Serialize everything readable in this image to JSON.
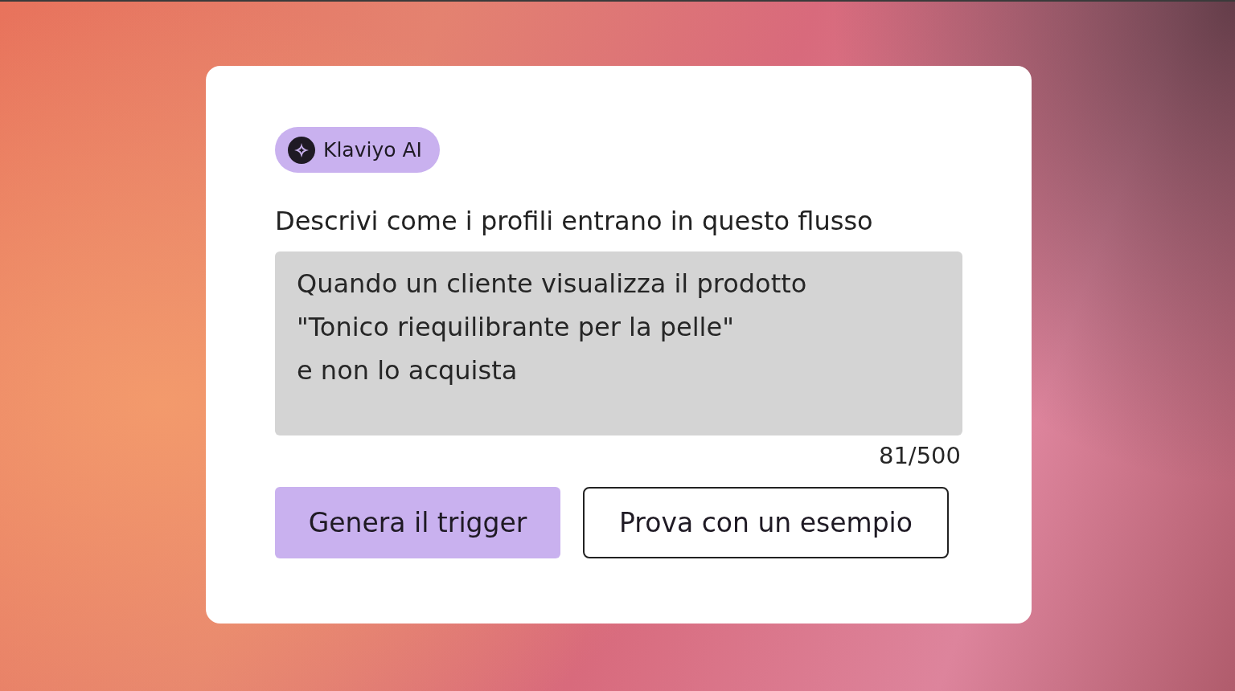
{
  "badge": {
    "label": "Klaviyo AI"
  },
  "prompt": {
    "label": "Descrivi come i profili entrano in questo flusso",
    "value": "Quando un cliente visualizza il prodotto\n\"Tonico riequilibrante per la pelle\"\ne non lo acquista",
    "counter": "81/500"
  },
  "buttons": [
    {
      "label": "Genera il trigger",
      "kind": "primary"
    },
    {
      "label": "Prova con un esempio",
      "kind": "secondary"
    }
  ]
}
